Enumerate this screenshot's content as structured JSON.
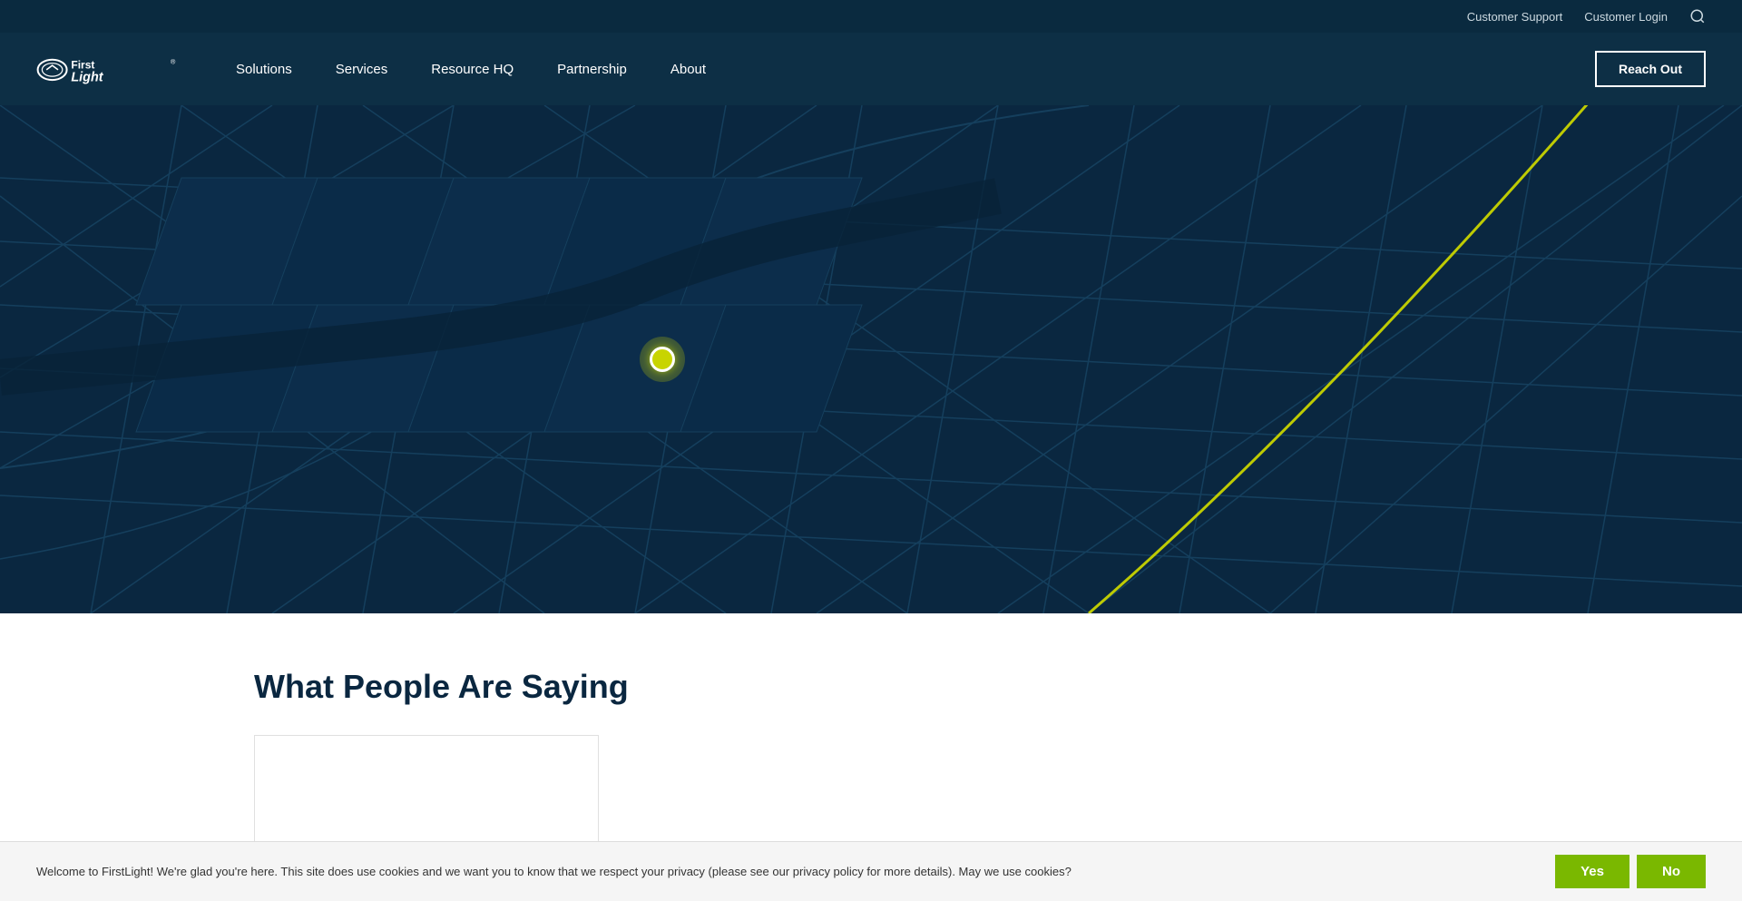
{
  "topBar": {
    "customerSupport": "Customer Support",
    "customerLogin": "Customer Login",
    "searchIcon": "search"
  },
  "nav": {
    "logoAlt": "FirstLight",
    "links": [
      {
        "label": "Solutions",
        "name": "solutions"
      },
      {
        "label": "Services",
        "name": "services"
      },
      {
        "label": "Resource HQ",
        "name": "resource-hq"
      },
      {
        "label": "Partnership",
        "name": "partnership"
      },
      {
        "label": "About",
        "name": "about"
      }
    ],
    "ctaButton": "Reach Out"
  },
  "hero": {
    "mapAlt": "City map background with location marker"
  },
  "testimonials": {
    "sectionTitle": "What People Are Saying"
  },
  "cookieBar": {
    "message": "Welcome to FirstLight! We're glad you're here. This site does use cookies and we want you to know that we respect your privacy (please see our privacy policy for more details). May we use cookies?",
    "yesLabel": "Yes",
    "noLabel": "No"
  }
}
